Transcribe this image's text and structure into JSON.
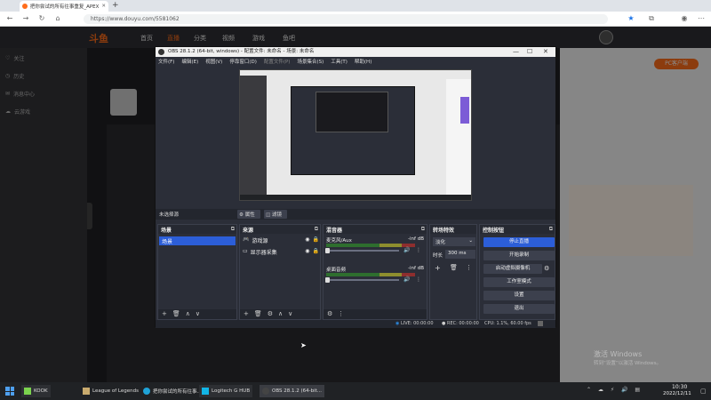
{
  "browser": {
    "tab_title": "把你尝试的所有往事重复_APEX",
    "url": "https://www.douyu.com/5581062"
  },
  "douyu": {
    "logo": "斗鱼",
    "nav": [
      "首页",
      "直播",
      "分类",
      "视频",
      "游戏",
      "鱼吧"
    ],
    "left_items": [
      "关注",
      "历史",
      "消息中心",
      "云游戏"
    ],
    "right_tab": "PC客户端",
    "watermark_title": "激活 Windows",
    "watermark_sub": "转到“设置”以激活 Windows。"
  },
  "obs": {
    "title": "OBS 28.1.2 (64-bit, windows) - 配置文件: 未命名 - 场景: 未命名",
    "menu": [
      "文件(F)",
      "编辑(E)",
      "视图(V)",
      "停靠窗口(D)",
      "配置文件(P)",
      "场景集合(S)",
      "工具(T)",
      "帮助(H)"
    ],
    "no_source": "未选择源",
    "props_btn": "属性",
    "filters_btn": "滤镜",
    "docks": {
      "scenes": {
        "title": "场景",
        "items": [
          "场景"
        ]
      },
      "sources": {
        "title": "来源",
        "items": [
          "游戏源",
          "显示器采集"
        ]
      },
      "mixer": {
        "title": "混音器",
        "tracks": [
          {
            "name": "麦克风/Aux",
            "level": "-inf dB"
          },
          {
            "name": "桌面音频",
            "level": "-inf dB"
          }
        ]
      },
      "transitions": {
        "title": "转场特效",
        "type": "淡化",
        "duration_label": "时长",
        "duration": "300 ms"
      },
      "controls": {
        "title": "控制按钮",
        "buttons": [
          "停止直播",
          "开始录制",
          "启动虚拟摄像机",
          "工作室模式",
          "设置",
          "退出"
        ]
      }
    },
    "status": {
      "live": "LIVE: 00:00:00",
      "rec": "REC: 00:00:00",
      "cpu": "CPU: 1.1%, 60.00 fps"
    }
  },
  "taskbar": {
    "items": [
      "KOOK",
      "League of Legends",
      "把你尝试的所有往事...",
      "Logitech G HUB",
      "OBS 28.1.2 (64-bit..."
    ],
    "time": "10:30",
    "date": "2022/12/11"
  },
  "colors": {
    "obs_accent": "#2c5ed8",
    "douyu_orange": "#ff6d1b"
  }
}
